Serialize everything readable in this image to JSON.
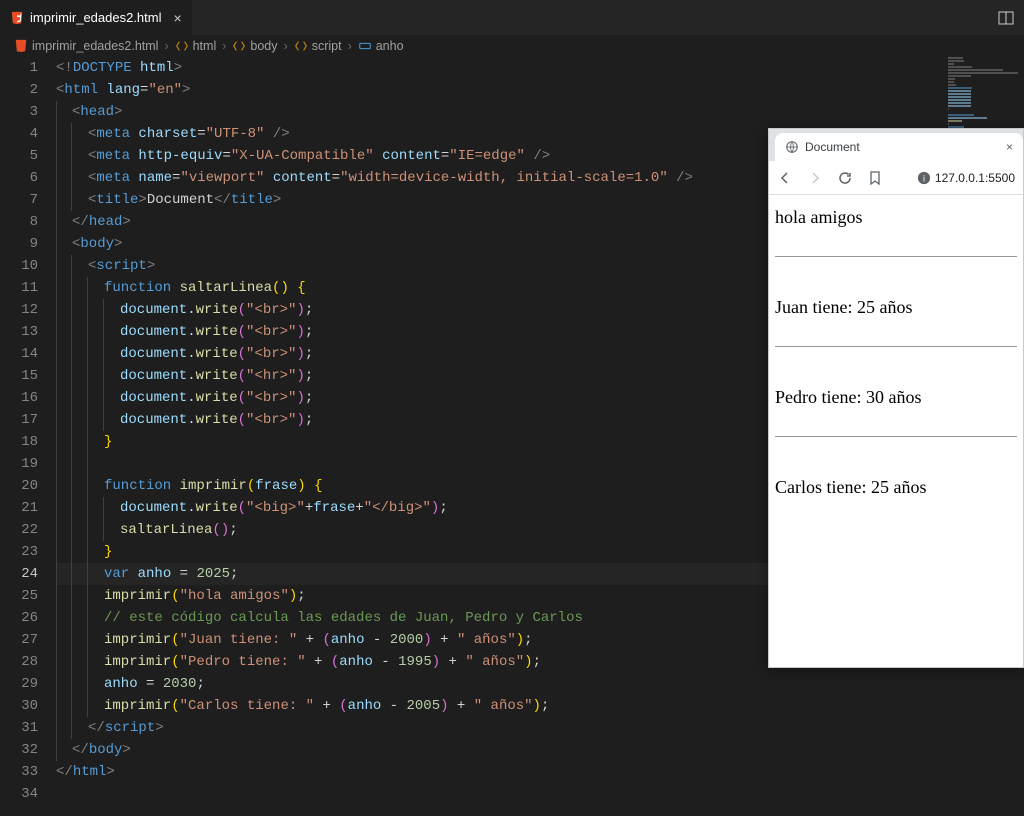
{
  "tab": {
    "title": "imprimir_edades2.html"
  },
  "breadcrumbs": {
    "file": "imprimir_edades2.html",
    "p1": "html",
    "p2": "body",
    "p3": "script",
    "p4": "anho"
  },
  "toolbar_icons": {
    "split": "split-editor"
  },
  "code": {
    "active_line": 24,
    "lines": [
      {
        "n": 1,
        "indent": 0,
        "guides": [],
        "segments": [
          [
            "t-gray",
            "<!"
          ],
          [
            "t-tag",
            "DOCTYPE "
          ],
          [
            "t-attr",
            "html"
          ],
          [
            "t-gray",
            ">"
          ]
        ]
      },
      {
        "n": 2,
        "indent": 0,
        "guides": [],
        "segments": [
          [
            "t-gray",
            "<"
          ],
          [
            "t-tag",
            "html "
          ],
          [
            "t-attr",
            "lang"
          ],
          [
            "t-white",
            "="
          ],
          [
            "t-str",
            "\"en\""
          ],
          [
            "t-gray",
            ">"
          ]
        ]
      },
      {
        "n": 3,
        "indent": 1,
        "guides": [
          1
        ],
        "segments": [
          [
            "t-gray",
            "<"
          ],
          [
            "t-tag",
            "head"
          ],
          [
            "t-gray",
            ">"
          ]
        ]
      },
      {
        "n": 4,
        "indent": 2,
        "guides": [
          1,
          2
        ],
        "segments": [
          [
            "t-gray",
            "<"
          ],
          [
            "t-tag",
            "meta "
          ],
          [
            "t-attr",
            "charset"
          ],
          [
            "t-white",
            "="
          ],
          [
            "t-str",
            "\"UTF-8\""
          ],
          [
            "t-gray",
            " />"
          ]
        ]
      },
      {
        "n": 5,
        "indent": 2,
        "guides": [
          1,
          2
        ],
        "segments": [
          [
            "t-gray",
            "<"
          ],
          [
            "t-tag",
            "meta "
          ],
          [
            "t-attr",
            "http-equiv"
          ],
          [
            "t-white",
            "="
          ],
          [
            "t-str",
            "\"X-UA-Compatible\""
          ],
          [
            "t-attr",
            " content"
          ],
          [
            "t-white",
            "="
          ],
          [
            "t-str",
            "\"IE=edge\""
          ],
          [
            "t-gray",
            " />"
          ]
        ]
      },
      {
        "n": 6,
        "indent": 2,
        "guides": [
          1,
          2
        ],
        "segments": [
          [
            "t-gray",
            "<"
          ],
          [
            "t-tag",
            "meta "
          ],
          [
            "t-attr",
            "name"
          ],
          [
            "t-white",
            "="
          ],
          [
            "t-str",
            "\"viewport\""
          ],
          [
            "t-attr",
            " content"
          ],
          [
            "t-white",
            "="
          ],
          [
            "t-str",
            "\"width=device-width, initial-scale=1.0\""
          ],
          [
            "t-gray",
            " />"
          ]
        ]
      },
      {
        "n": 7,
        "indent": 2,
        "guides": [
          1,
          2
        ],
        "segments": [
          [
            "t-gray",
            "<"
          ],
          [
            "t-tag",
            "title"
          ],
          [
            "t-gray",
            ">"
          ],
          [
            "t-white",
            "Document"
          ],
          [
            "t-gray",
            "</"
          ],
          [
            "t-tag",
            "title"
          ],
          [
            "t-gray",
            ">"
          ]
        ]
      },
      {
        "n": 8,
        "indent": 1,
        "guides": [
          1
        ],
        "segments": [
          [
            "t-gray",
            "</"
          ],
          [
            "t-tag",
            "head"
          ],
          [
            "t-gray",
            ">"
          ]
        ]
      },
      {
        "n": 9,
        "indent": 1,
        "guides": [
          1
        ],
        "segments": [
          [
            "t-gray",
            "<"
          ],
          [
            "t-tag",
            "body"
          ],
          [
            "t-gray",
            ">"
          ]
        ]
      },
      {
        "n": 10,
        "indent": 2,
        "guides": [
          1,
          2
        ],
        "segments": [
          [
            "t-gray",
            "<"
          ],
          [
            "t-tag",
            "script"
          ],
          [
            "t-gray",
            ">"
          ]
        ]
      },
      {
        "n": 11,
        "indent": 3,
        "guides": [
          1,
          2,
          3
        ],
        "segments": [
          [
            "t-kw",
            "function "
          ],
          [
            "t-fn",
            "saltarLinea"
          ],
          [
            "t-yellow",
            "() {"
          ]
        ]
      },
      {
        "n": 12,
        "indent": 4,
        "guides": [
          1,
          2,
          3,
          4
        ],
        "segments": [
          [
            "t-var",
            "document"
          ],
          [
            "t-white",
            "."
          ],
          [
            "t-fn",
            "write"
          ],
          [
            "t-pink",
            "("
          ],
          [
            "t-str",
            "\"<br>\""
          ],
          [
            "t-pink",
            ")"
          ],
          [
            "t-white",
            ";"
          ]
        ]
      },
      {
        "n": 13,
        "indent": 4,
        "guides": [
          1,
          2,
          3,
          4
        ],
        "segments": [
          [
            "t-var",
            "document"
          ],
          [
            "t-white",
            "."
          ],
          [
            "t-fn",
            "write"
          ],
          [
            "t-pink",
            "("
          ],
          [
            "t-str",
            "\"<br>\""
          ],
          [
            "t-pink",
            ")"
          ],
          [
            "t-white",
            ";"
          ]
        ]
      },
      {
        "n": 14,
        "indent": 4,
        "guides": [
          1,
          2,
          3,
          4
        ],
        "segments": [
          [
            "t-var",
            "document"
          ],
          [
            "t-white",
            "."
          ],
          [
            "t-fn",
            "write"
          ],
          [
            "t-pink",
            "("
          ],
          [
            "t-str",
            "\"<br>\""
          ],
          [
            "t-pink",
            ")"
          ],
          [
            "t-white",
            ";"
          ]
        ]
      },
      {
        "n": 15,
        "indent": 4,
        "guides": [
          1,
          2,
          3,
          4
        ],
        "segments": [
          [
            "t-var",
            "document"
          ],
          [
            "t-white",
            "."
          ],
          [
            "t-fn",
            "write"
          ],
          [
            "t-pink",
            "("
          ],
          [
            "t-str",
            "\"<hr>\""
          ],
          [
            "t-pink",
            ")"
          ],
          [
            "t-white",
            ";"
          ]
        ]
      },
      {
        "n": 16,
        "indent": 4,
        "guides": [
          1,
          2,
          3,
          4
        ],
        "segments": [
          [
            "t-var",
            "document"
          ],
          [
            "t-white",
            "."
          ],
          [
            "t-fn",
            "write"
          ],
          [
            "t-pink",
            "("
          ],
          [
            "t-str",
            "\"<br>\""
          ],
          [
            "t-pink",
            ")"
          ],
          [
            "t-white",
            ";"
          ]
        ]
      },
      {
        "n": 17,
        "indent": 4,
        "guides": [
          1,
          2,
          3,
          4
        ],
        "segments": [
          [
            "t-var",
            "document"
          ],
          [
            "t-white",
            "."
          ],
          [
            "t-fn",
            "write"
          ],
          [
            "t-pink",
            "("
          ],
          [
            "t-str",
            "\"<br>\""
          ],
          [
            "t-pink",
            ")"
          ],
          [
            "t-white",
            ";"
          ]
        ]
      },
      {
        "n": 18,
        "indent": 3,
        "guides": [
          1,
          2,
          3
        ],
        "segments": [
          [
            "t-yellow",
            "}"
          ]
        ]
      },
      {
        "n": 19,
        "indent": 0,
        "guides": [
          1,
          2,
          3
        ],
        "segments": []
      },
      {
        "n": 20,
        "indent": 3,
        "guides": [
          1,
          2,
          3
        ],
        "segments": [
          [
            "t-kw",
            "function "
          ],
          [
            "t-fn",
            "imprimir"
          ],
          [
            "t-yellow",
            "("
          ],
          [
            "t-var",
            "frase"
          ],
          [
            "t-yellow",
            ") {"
          ]
        ]
      },
      {
        "n": 21,
        "indent": 4,
        "guides": [
          1,
          2,
          3,
          4
        ],
        "segments": [
          [
            "t-var",
            "document"
          ],
          [
            "t-white",
            "."
          ],
          [
            "t-fn",
            "write"
          ],
          [
            "t-pink",
            "("
          ],
          [
            "t-str",
            "\"<big>\""
          ],
          [
            "t-white",
            "+"
          ],
          [
            "t-var",
            "frase"
          ],
          [
            "t-white",
            "+"
          ],
          [
            "t-str",
            "\"</big>\""
          ],
          [
            "t-pink",
            ")"
          ],
          [
            "t-white",
            ";"
          ]
        ]
      },
      {
        "n": 22,
        "indent": 4,
        "guides": [
          1,
          2,
          3,
          4
        ],
        "segments": [
          [
            "t-fn",
            "saltarLinea"
          ],
          [
            "t-pink",
            "()"
          ],
          [
            "t-white",
            ";"
          ]
        ]
      },
      {
        "n": 23,
        "indent": 3,
        "guides": [
          1,
          2,
          3
        ],
        "segments": [
          [
            "t-yellow",
            "}"
          ]
        ]
      },
      {
        "n": 24,
        "indent": 3,
        "guides": [
          1,
          2,
          3
        ],
        "segments": [
          [
            "t-kw",
            "var "
          ],
          [
            "t-var",
            "anho"
          ],
          [
            "t-white",
            " = "
          ],
          [
            "t-num",
            "2025"
          ],
          [
            "t-white",
            ";"
          ]
        ]
      },
      {
        "n": 25,
        "indent": 3,
        "guides": [
          1,
          2,
          3
        ],
        "segments": [
          [
            "t-fn",
            "imprimir"
          ],
          [
            "t-yellow",
            "("
          ],
          [
            "t-str",
            "\"hola amigos\""
          ],
          [
            "t-yellow",
            ")"
          ],
          [
            "t-white",
            ";"
          ]
        ]
      },
      {
        "n": 26,
        "indent": 3,
        "guides": [
          1,
          2,
          3
        ],
        "segments": [
          [
            "t-comment",
            "// este código calcula las edades de Juan, Pedro y Carlos"
          ]
        ]
      },
      {
        "n": 27,
        "indent": 3,
        "guides": [
          1,
          2,
          3
        ],
        "segments": [
          [
            "t-fn",
            "imprimir"
          ],
          [
            "t-yellow",
            "("
          ],
          [
            "t-str",
            "\"Juan tiene: \""
          ],
          [
            "t-white",
            " + "
          ],
          [
            "t-pink",
            "("
          ],
          [
            "t-var",
            "anho"
          ],
          [
            "t-white",
            " - "
          ],
          [
            "t-num",
            "2000"
          ],
          [
            "t-pink",
            ")"
          ],
          [
            "t-white",
            " + "
          ],
          [
            "t-str",
            "\" años\""
          ],
          [
            "t-yellow",
            ")"
          ],
          [
            "t-white",
            ";"
          ]
        ]
      },
      {
        "n": 28,
        "indent": 3,
        "guides": [
          1,
          2,
          3
        ],
        "segments": [
          [
            "t-fn",
            "imprimir"
          ],
          [
            "t-yellow",
            "("
          ],
          [
            "t-str",
            "\"Pedro tiene: \""
          ],
          [
            "t-white",
            " + "
          ],
          [
            "t-pink",
            "("
          ],
          [
            "t-var",
            "anho"
          ],
          [
            "t-white",
            " - "
          ],
          [
            "t-num",
            "1995"
          ],
          [
            "t-pink",
            ")"
          ],
          [
            "t-white",
            " + "
          ],
          [
            "t-str",
            "\" años\""
          ],
          [
            "t-yellow",
            ")"
          ],
          [
            "t-white",
            ";"
          ]
        ]
      },
      {
        "n": 29,
        "indent": 3,
        "guides": [
          1,
          2,
          3
        ],
        "segments": [
          [
            "t-var",
            "anho"
          ],
          [
            "t-white",
            " = "
          ],
          [
            "t-num",
            "2030"
          ],
          [
            "t-white",
            ";"
          ]
        ]
      },
      {
        "n": 30,
        "indent": 3,
        "guides": [
          1,
          2,
          3
        ],
        "segments": [
          [
            "t-fn",
            "imprimir"
          ],
          [
            "t-yellow",
            "("
          ],
          [
            "t-str",
            "\"Carlos tiene: \""
          ],
          [
            "t-white",
            " + "
          ],
          [
            "t-pink",
            "("
          ],
          [
            "t-var",
            "anho"
          ],
          [
            "t-white",
            " - "
          ],
          [
            "t-num",
            "2005"
          ],
          [
            "t-pink",
            ")"
          ],
          [
            "t-white",
            " + "
          ],
          [
            "t-str",
            "\" años\""
          ],
          [
            "t-yellow",
            ")"
          ],
          [
            "t-white",
            ";"
          ]
        ]
      },
      {
        "n": 31,
        "indent": 2,
        "guides": [
          1,
          2
        ],
        "segments": [
          [
            "t-gray",
            "</"
          ],
          [
            "t-tag",
            "script"
          ],
          [
            "t-gray",
            ">"
          ]
        ]
      },
      {
        "n": 32,
        "indent": 1,
        "guides": [
          1
        ],
        "segments": [
          [
            "t-gray",
            "</"
          ],
          [
            "t-tag",
            "body"
          ],
          [
            "t-gray",
            ">"
          ]
        ]
      },
      {
        "n": 33,
        "indent": 0,
        "guides": [],
        "segments": [
          [
            "t-gray",
            "</"
          ],
          [
            "t-tag",
            "html"
          ],
          [
            "t-gray",
            ">"
          ]
        ]
      },
      {
        "n": 34,
        "indent": 0,
        "guides": [],
        "segments": []
      }
    ]
  },
  "preview": {
    "tab_title": "Document",
    "url": "127.0.0.1:5500",
    "lines": [
      "hola amigos",
      "Juan tiene: 25 años",
      "Pedro tiene: 30 años",
      "Carlos tiene: 25 años"
    ]
  }
}
